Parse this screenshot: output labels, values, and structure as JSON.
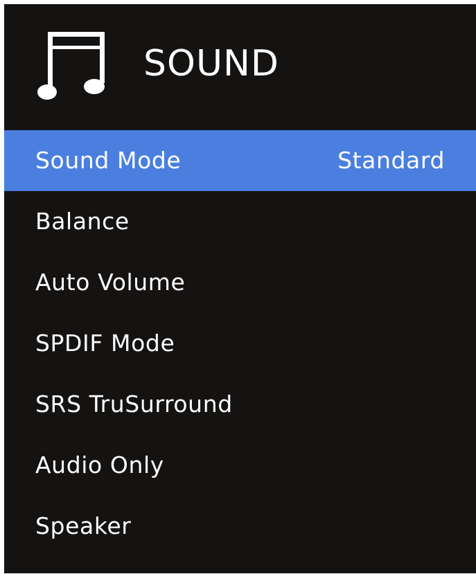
{
  "header": {
    "title": "SOUND",
    "icon": "music-note-icon"
  },
  "menu": {
    "items": [
      {
        "label": "Sound Mode",
        "value": "Standard",
        "selected": true
      },
      {
        "label": "Balance",
        "value": ""
      },
      {
        "label": "Auto Volume",
        "value": ""
      },
      {
        "label": "SPDIF Mode",
        "value": ""
      },
      {
        "label": "SRS TruSurround",
        "value": ""
      },
      {
        "label": "Audio Only",
        "value": ""
      },
      {
        "label": "Speaker",
        "value": ""
      }
    ]
  },
  "colors": {
    "background": "#151312",
    "accent": "#4a7fe0",
    "text": "#ffffff"
  }
}
